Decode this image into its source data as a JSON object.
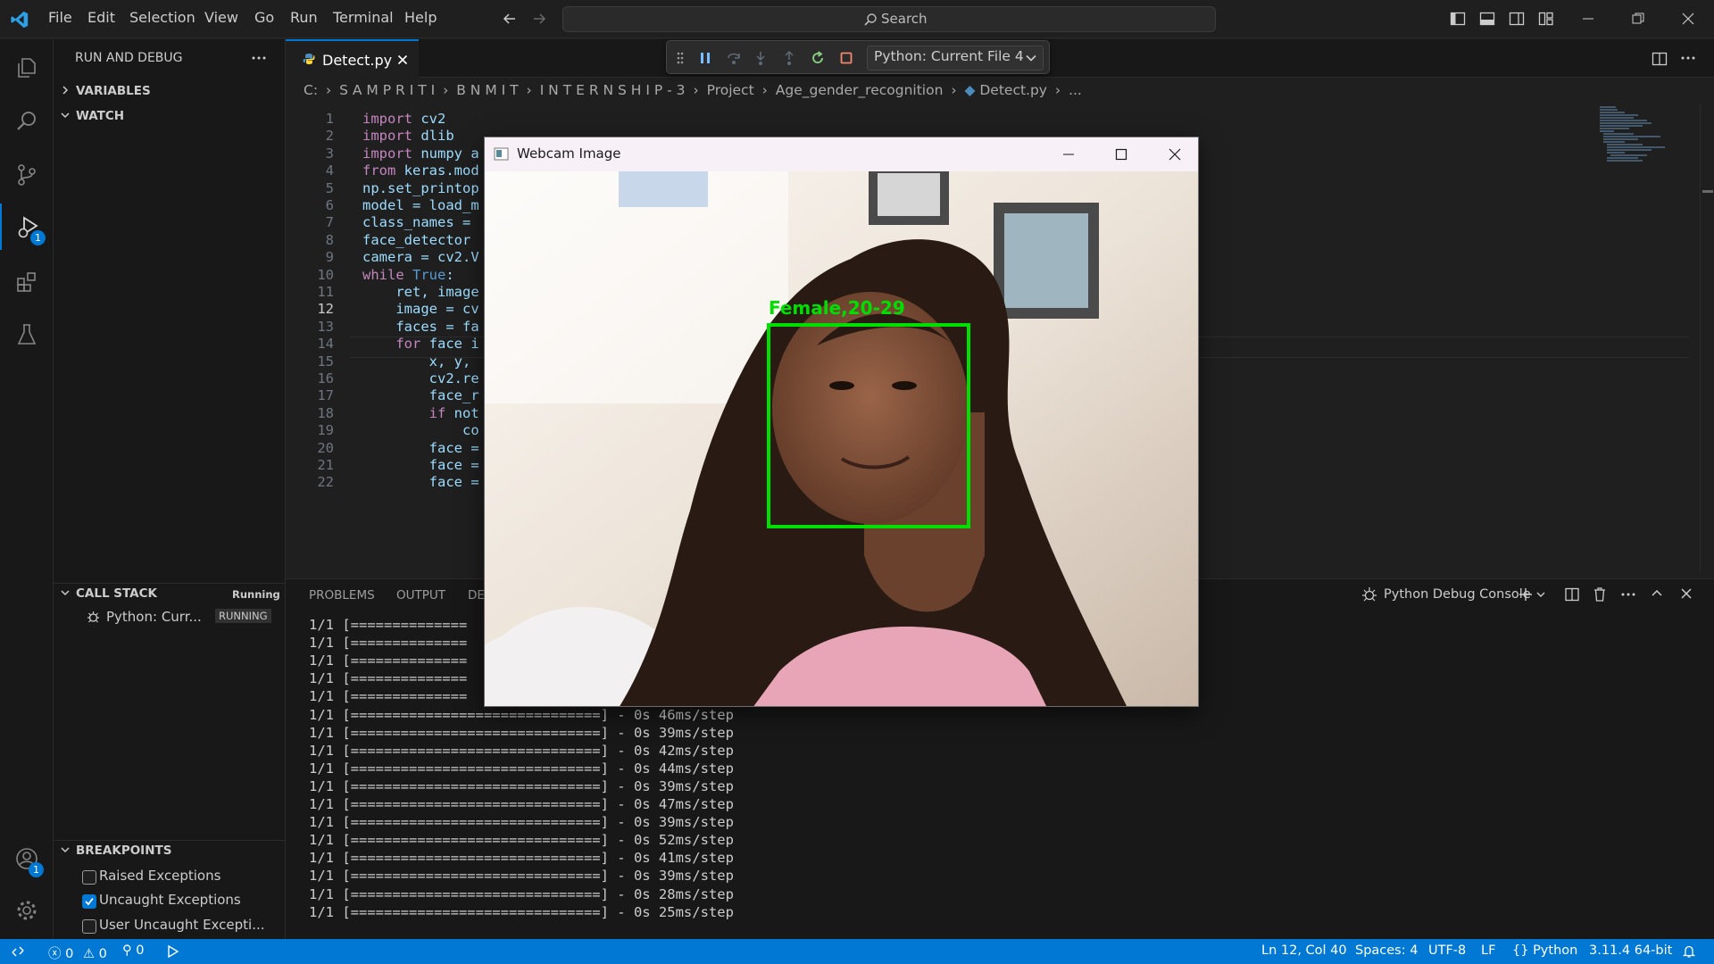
{
  "menu": [
    "File",
    "Edit",
    "Selection",
    "View",
    "Go",
    "Run",
    "Terminal",
    "Help"
  ],
  "search": {
    "placeholder": "Search"
  },
  "sidebar": {
    "title": "RUN AND DEBUG",
    "sections": {
      "variables": "VARIABLES",
      "watch": "WATCH",
      "call_stack": "CALL STACK",
      "breakpoints": "BREAKPOINTS"
    },
    "call_stack_status": "Running",
    "call_stack_item": {
      "label": "Python: Curr...",
      "status": "RUNNING"
    },
    "breakpoints": [
      {
        "label": "Raised Exceptions",
        "checked": false
      },
      {
        "label": "Uncaught Exceptions",
        "checked": true
      },
      {
        "label": "User Uncaught Excepti...",
        "checked": false
      }
    ]
  },
  "activity_badges": {
    "run_debug": "1",
    "accounts": "1"
  },
  "tab": {
    "label": "Detect.py"
  },
  "debug_config": "Python: Current File 4",
  "breadcrumb": [
    "C:",
    "S A M P R I T I",
    "B N M I T",
    "I N T E R N S H I P - 3",
    "Project",
    "Age_gender_recognition",
    "Detect.py",
    "..."
  ],
  "code": {
    "current_line": 12,
    "lines": [
      {
        "n": "1",
        "text": "import cv2"
      },
      {
        "n": "2",
        "text": "import dlib"
      },
      {
        "n": "3",
        "text": "import numpy a"
      },
      {
        "n": "4",
        "text": "from keras.mod"
      },
      {
        "n": "5",
        "text": "np.set_printop"
      },
      {
        "n": "6",
        "text": "model = load_m"
      },
      {
        "n": "7",
        "text": "class_names = "
      },
      {
        "n": "8",
        "text": "face_detector "
      },
      {
        "n": "9",
        "text": "camera = cv2.V"
      },
      {
        "n": "10",
        "text": "while True:"
      },
      {
        "n": "11",
        "text": "    ret, image"
      },
      {
        "n": "12",
        "text": "    image = cv"
      },
      {
        "n": "13",
        "text": "    faces = fa"
      },
      {
        "n": "14",
        "text": "    for face i"
      },
      {
        "n": "15",
        "text": "        x, y, "
      },
      {
        "n": "16",
        "text": "        cv2.re"
      },
      {
        "n": "17",
        "text": "        face_r"
      },
      {
        "n": "18",
        "text": "        if not"
      },
      {
        "n": "19",
        "text": "            co"
      },
      {
        "n": "20",
        "text": "        face ="
      },
      {
        "n": "21",
        "text": "        face ="
      },
      {
        "n": "22",
        "text": "        face ="
      }
    ]
  },
  "panel": {
    "tabs": [
      "PROBLEMS",
      "OUTPUT",
      "DE"
    ],
    "console_label": "Python Debug Console",
    "output_lines": [
      "1/1 [==============",
      "1/1 [==============",
      "1/1 [==============",
      "1/1 [==============",
      "1/1 [==============",
      "1/1 [==============================] - 0s 46ms/step",
      "1/1 [==============================] - 0s 39ms/step",
      "1/1 [==============================] - 0s 42ms/step",
      "1/1 [==============================] - 0s 44ms/step",
      "1/1 [==============================] - 0s 39ms/step",
      "1/1 [==============================] - 0s 47ms/step",
      "1/1 [==============================] - 0s 39ms/step",
      "1/1 [==============================] - 0s 52ms/step",
      "1/1 [==============================] - 0s 41ms/step",
      "1/1 [==============================] - 0s 39ms/step",
      "1/1 [==============================] - 0s 28ms/step",
      "1/1 [==============================] - 0s 25ms/step"
    ]
  },
  "webcam": {
    "title": "Webcam Image",
    "detection_label": "Female,20-29",
    "box_color": "#00e000"
  },
  "statusbar": {
    "errors": "0",
    "warnings": "0",
    "ports": "0",
    "position": "Ln 12, Col 40",
    "spaces": "Spaces: 4",
    "encoding": "UTF-8",
    "eol": "LF",
    "language": "Python",
    "interpreter": "3.11.4 64-bit"
  },
  "colors": {
    "accent": "#0078d4",
    "editor_bg": "#1f1f1f",
    "sidebar_bg": "#181818"
  }
}
